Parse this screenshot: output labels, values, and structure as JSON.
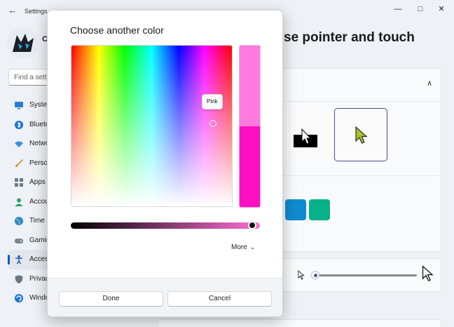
{
  "window": {
    "title": "Settings",
    "back_icon": "←",
    "minimize_icon": "—",
    "maximize_icon": "□",
    "close_icon": "✕"
  },
  "user": {
    "name": "C"
  },
  "search": {
    "placeholder": "Find a setti"
  },
  "sidebar": {
    "items": [
      {
        "label": "Syster",
        "icon": "monitor-icon"
      },
      {
        "label": "Blueto",
        "icon": "bluetooth-icon"
      },
      {
        "label": "Netwo",
        "icon": "wifi-icon"
      },
      {
        "label": "Persor",
        "icon": "brush-icon"
      },
      {
        "label": "Apps",
        "icon": "apps-icon"
      },
      {
        "label": "Accou",
        "icon": "person-icon"
      },
      {
        "label": "Time",
        "icon": "globe-icon"
      },
      {
        "label": "Gamin",
        "icon": "gamepad-icon"
      },
      {
        "label": "Acces",
        "icon": "accessibility-icon",
        "active": true
      },
      {
        "label": "Privac",
        "icon": "shield-icon"
      },
      {
        "label": "Windo",
        "icon": "update-icon"
      }
    ]
  },
  "page": {
    "heading": "se pointer and touch"
  },
  "cards": {
    "expand_chevron": "∧"
  },
  "colors": {
    "accent": "#005fb8",
    "new_color": "#ff7ade",
    "current_color": "#ff0fc3",
    "swatch_blue": "#0e8bd0",
    "swatch_teal": "#07b18a",
    "pointer_custom": "#a7c224"
  },
  "dialog": {
    "title": "Choose another color",
    "tooltip": "Pink",
    "value_level": 0.98,
    "more_label": "More",
    "more_chevron": "⌵",
    "done_label": "Done",
    "cancel_label": "Cancel"
  }
}
